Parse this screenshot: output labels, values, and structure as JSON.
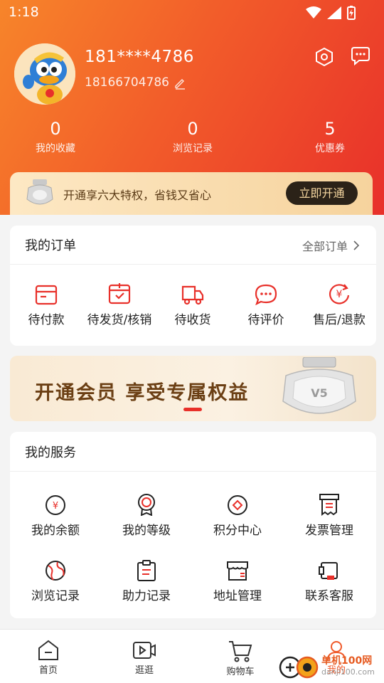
{
  "status": {
    "time": "1:18"
  },
  "profile": {
    "masked_phone": "181****4786",
    "phone": "18166704786"
  },
  "stats": [
    {
      "value": "0",
      "label": "我的收藏"
    },
    {
      "value": "0",
      "label": "浏览记录"
    },
    {
      "value": "5",
      "label": "优惠券"
    }
  ],
  "vip": {
    "text": "开通享六大特权，省钱又省心",
    "button": "立即开通"
  },
  "orders": {
    "title": "我的订单",
    "all_label": "全部订单",
    "items": [
      {
        "label": "待付款",
        "icon": "wallet-icon"
      },
      {
        "label": "待发货/核销",
        "icon": "package-check-icon"
      },
      {
        "label": "待收货",
        "icon": "truck-icon"
      },
      {
        "label": "待评价",
        "icon": "comment-icon"
      },
      {
        "label": "售后/退款",
        "icon": "refund-icon"
      }
    ]
  },
  "banner": {
    "text": "开通会员  享受专属权益"
  },
  "services": {
    "title": "我的服务",
    "items": [
      {
        "label": "我的余额",
        "icon": "yen-circle-icon"
      },
      {
        "label": "我的等级",
        "icon": "medal-icon"
      },
      {
        "label": "积分中心",
        "icon": "diamond-circle-icon"
      },
      {
        "label": "发票管理",
        "icon": "invoice-icon"
      },
      {
        "label": "浏览记录",
        "icon": "globe-icon"
      },
      {
        "label": "助力记录",
        "icon": "clipboard-icon"
      },
      {
        "label": "地址管理",
        "icon": "store-icon"
      },
      {
        "label": "联系客服",
        "icon": "phone-service-icon"
      }
    ]
  },
  "tabbar": [
    {
      "label": "首页",
      "icon": "home-icon"
    },
    {
      "label": "逛逛",
      "icon": "video-icon"
    },
    {
      "label": "购物车",
      "icon": "cart-icon"
    },
    {
      "label": "我的",
      "icon": "user-icon"
    }
  ],
  "watermark": {
    "text": "单机100网",
    "url": "danji100.com"
  },
  "colors": {
    "accent": "#e8302a",
    "gradient_start": "#f7852a",
    "vip_dark": "#2b2218"
  }
}
